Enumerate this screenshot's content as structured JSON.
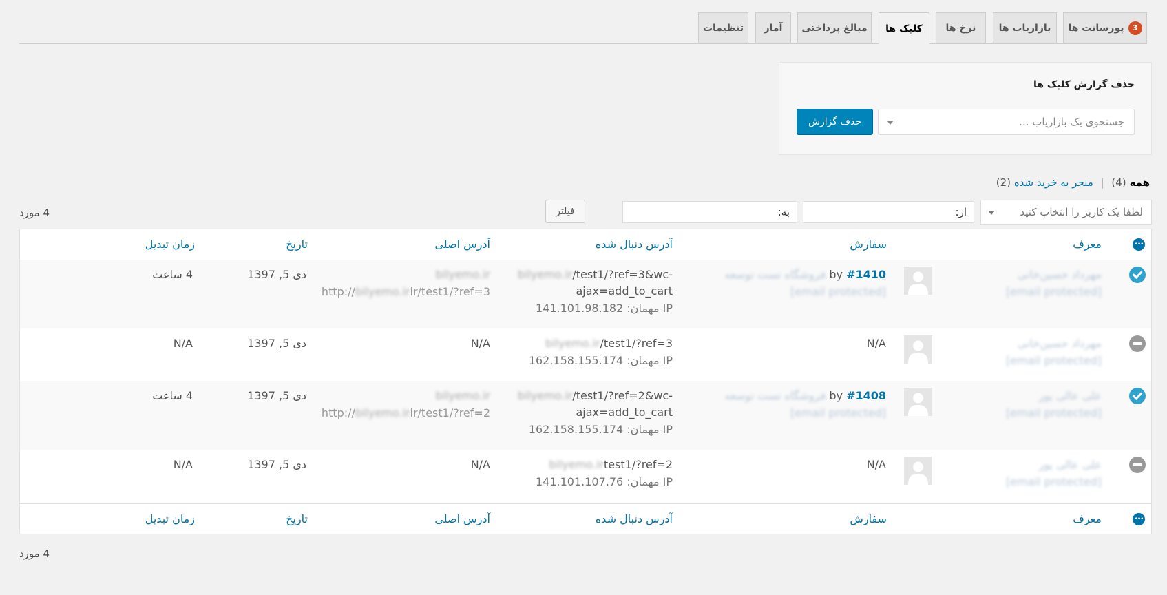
{
  "tabs": [
    {
      "label": "پورسانت ها",
      "badge": "3"
    },
    {
      "label": "بازاریاب ها"
    },
    {
      "label": "نرخ ها"
    },
    {
      "label": "کلیک ها"
    },
    {
      "label": "مبالغ پرداختی"
    },
    {
      "label": "آمار"
    },
    {
      "label": "تنظیمات"
    }
  ],
  "delete_box": {
    "title": "حذف گزارش کلیک ها",
    "select_placeholder": "جستجوی یک بازاریاب ...",
    "button": "حذف گزارش"
  },
  "views": {
    "all_label": "همه",
    "all_count": "(4)",
    "converted_label": "منجر به خرید شده",
    "converted_count": "(2)"
  },
  "filters": {
    "user_placeholder": "لطفا یک کاربر را انتخاب کنید",
    "from_label": "از:",
    "to_label": "به:",
    "button": "فیلتر",
    "items_count": "4 مورد"
  },
  "columns": {
    "referrer": "معرف",
    "order": "سفارش",
    "tracked_url": "آدرس دنبال شده",
    "original_url": "آدرس اصلی",
    "date": "تاریخ",
    "conversion_time": "زمان تبدیل"
  },
  "rows": [
    {
      "status": "converted",
      "referrer_name": "مهرداد حسین‌خانی",
      "referrer_email": "[email protected]",
      "order_link": "#1410",
      "order_by": "by",
      "order_customer": "فروشگاه تست توسعه",
      "order_email": "[email protected]",
      "tracked_domain": "bilyemo.ir",
      "tracked_path_1": "/test1/?ref=3&wc-",
      "tracked_path_2": "ajax=add_to_cart",
      "ip_label": "IP مهمان:",
      "ip": "141.101.98.182",
      "orig_domain": "bilyemo.ir",
      "orig_prefix": "http://",
      "orig_suffix": "ir/test1/?ref=3",
      "date": "دی 5, 1397",
      "conversion": "4 ساعت"
    },
    {
      "status": "none",
      "referrer_name": "مهرداد حسین‌خانی",
      "referrer_email": "[email protected]",
      "order_na": "N/A",
      "tracked_domain": "bilyemo.ir",
      "tracked_path_1": "/test1/?ref=3",
      "ip_label": "IP مهمان:",
      "ip": "162.158.155.174",
      "orig_na": "N/A",
      "date": "دی 5, 1397",
      "conversion": "N/A"
    },
    {
      "status": "converted",
      "referrer_name": "علی عالی پور",
      "referrer_email": "[email protected]",
      "order_link": "#1408",
      "order_by": "by",
      "order_customer": "فروشگاه تست توسعه",
      "order_email": "[email protected]",
      "tracked_domain": "bilyemo.ir",
      "tracked_path_1": "/test1/?ref=2&wc-",
      "tracked_path_2": "ajax=add_to_cart",
      "ip_label": "IP مهمان:",
      "ip": "162.158.155.174",
      "orig_domain": "bilyemo.ir",
      "orig_prefix": "http://",
      "orig_suffix": "ir/test1/?ref=2",
      "date": "دی 5, 1397",
      "conversion": "4 ساعت"
    },
    {
      "status": "none",
      "referrer_name": "علی عالی پور",
      "referrer_email": "[email protected]",
      "order_na": "N/A",
      "tracked_domain": "bilyemo.ir",
      "tracked_path_1": "test1/?ref=2",
      "ip_label": "IP مهمان:",
      "ip": "141.101.107.76",
      "orig_na": "N/A",
      "date": "دی 5, 1397",
      "conversion": "N/A"
    }
  ]
}
